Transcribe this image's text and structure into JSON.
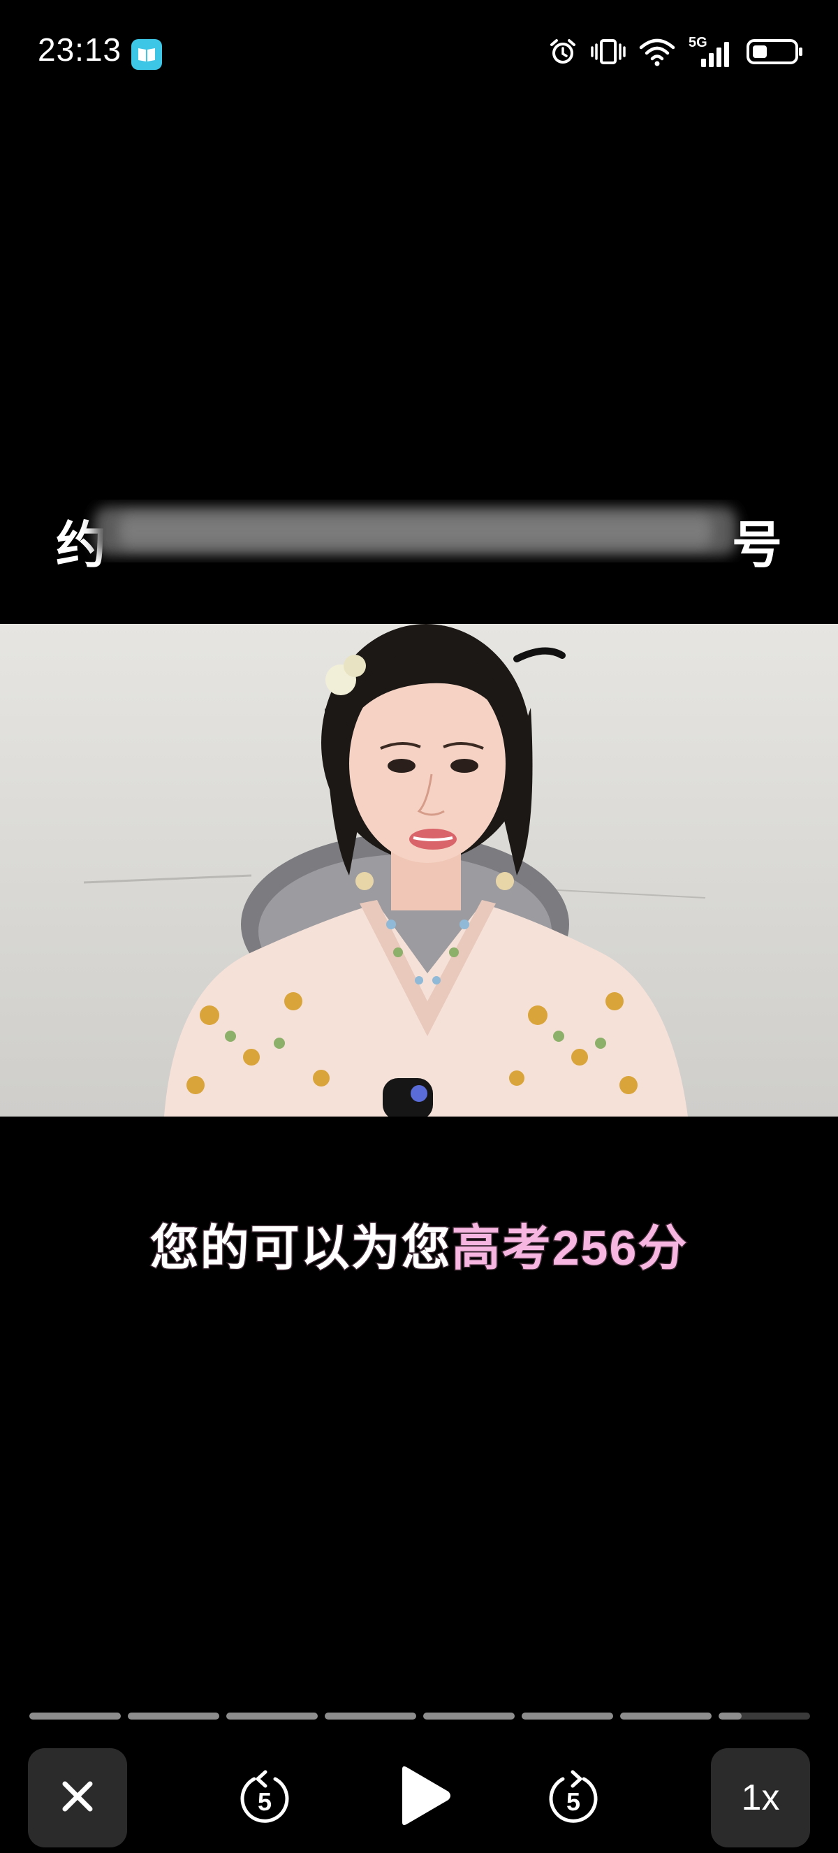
{
  "status_bar": {
    "time": "23:13",
    "network_label": "5G",
    "icons": [
      "book-app-icon",
      "alarm-icon",
      "vibrate-icon",
      "wifi-icon",
      "signal-icon",
      "battery-icon"
    ]
  },
  "video": {
    "caption_white": "您的可以为您",
    "caption_pink": "高考256分",
    "top_subtitle_left": "约",
    "top_subtitle_right": "号"
  },
  "progress": {
    "segments": 8,
    "completed_segments": 7,
    "current_segment_fraction": 0.25
  },
  "controls": {
    "rewind_seconds": "5",
    "forward_seconds": "5",
    "speed": "1x"
  },
  "colors": {
    "background": "#000000",
    "caption_accent": "#f7b6e2",
    "app_icon": "#3ec6e6",
    "control_box": "#2b2b2b"
  }
}
